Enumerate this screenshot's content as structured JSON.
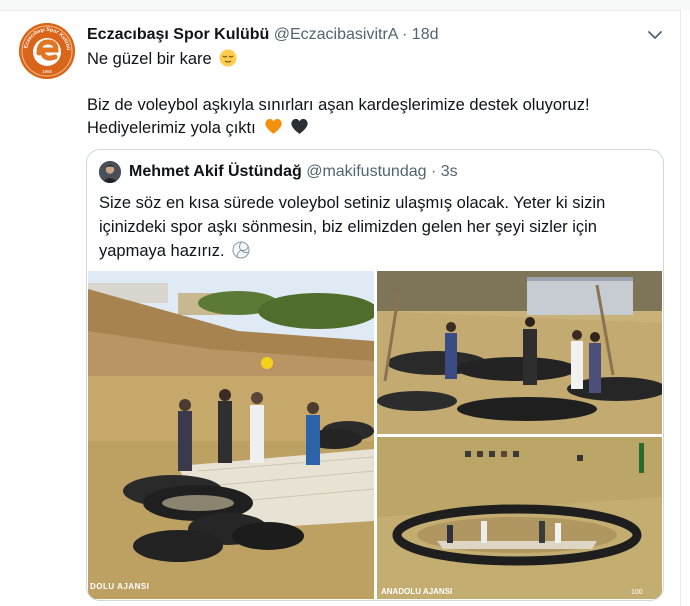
{
  "tweet": {
    "display_name": "Eczacıbaşı Spor Kulübü",
    "handle": "@EczacibasivitrA",
    "separator": "·",
    "time": "18d",
    "avatar_text": "Eczacıbaşı Spor Kulübü",
    "avatar_year": "1966",
    "line1": "Ne güzel bir kare",
    "line2": "Biz de voleybol aşkıyla sınırları aşan kardeşlerimize destek oluyoruz!",
    "line3": "Hediyelerimiz yola çıktı",
    "emojis": [
      "relieved-face",
      "orange-heart",
      "black-heart"
    ]
  },
  "quoted": {
    "display_name": "Mehmet Akif Üstündağ",
    "handle": "@makifustundag",
    "separator": "·",
    "time": "3s",
    "text": "Size söz en kısa sürede voleybol setiniz ulaşmış olacak. Yeter ki sizin içinizdeki spor aşkı sönmesin, biz elimizden gelen her şeyi sizler için yapmaya hazırız.",
    "emoji": "volleyball",
    "photos": [
      {
        "watermark": "DOLU AJANSI"
      },
      {
        "watermark": ""
      },
      {
        "watermark": "ANADOLU AJANSI",
        "badge": "100"
      }
    ]
  },
  "colors": {
    "accent_orange": "#f28c18",
    "muted_text": "#536471",
    "border": "#cfd9de"
  }
}
